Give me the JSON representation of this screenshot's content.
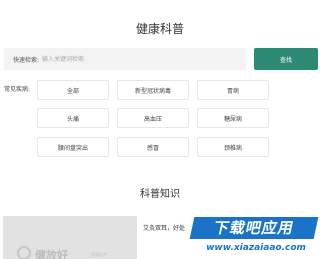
{
  "header": {
    "title": "健康科普"
  },
  "search": {
    "label": "快速检索:",
    "placeholder": "输入关键词检索",
    "value": "",
    "button_label": "查找"
  },
  "categories": {
    "label": "常见疾病:",
    "items": [
      "全部",
      "新型冠状病毒",
      "胃病",
      "头痛",
      "高血压",
      "糖尿病",
      "腰间盘突出",
      "感冒",
      "颈椎病"
    ]
  },
  "knowledge": {
    "title": "科普知识",
    "article": {
      "thumbnail_text": "健放好",
      "thumbnail_subtext": "健康科普",
      "snippet": "艾灸双耳，好处"
    }
  },
  "watermark": {
    "line1": "下载吧应用",
    "line2": "www.xiazaiaao.com",
    "color": "#1a73c9"
  },
  "colors": {
    "accent": "#2e8b73"
  }
}
